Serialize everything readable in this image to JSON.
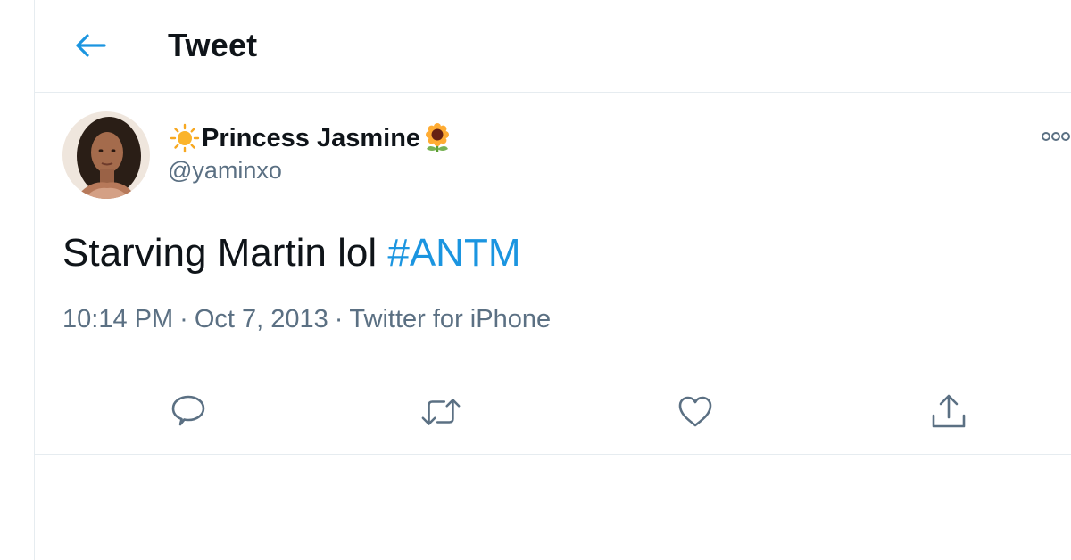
{
  "header": {
    "title": "Tweet",
    "back_icon": "arrow-left-icon"
  },
  "author": {
    "display_name": "Princess Jasmine",
    "name_prefix_emoji": "sun-emoji",
    "name_suffix_emoji": "sunflower-emoji",
    "handle": "@yaminxo",
    "avatar": "profile-photo"
  },
  "tweet": {
    "text": "Starving Martin lol ",
    "hashtag": "#ANTM",
    "time": "10:14 PM",
    "separator": "·",
    "date": "Oct 7, 2013",
    "source": "Twitter for iPhone"
  },
  "actions": [
    {
      "name": "reply",
      "icon": "speech-bubble-icon"
    },
    {
      "name": "retweet",
      "icon": "retweet-icon"
    },
    {
      "name": "like",
      "icon": "heart-icon"
    },
    {
      "name": "share",
      "icon": "share-icon"
    }
  ],
  "colors": {
    "accent": "#1b95e0",
    "secondary_text": "#5b7083",
    "border": "#e6ecf0"
  }
}
